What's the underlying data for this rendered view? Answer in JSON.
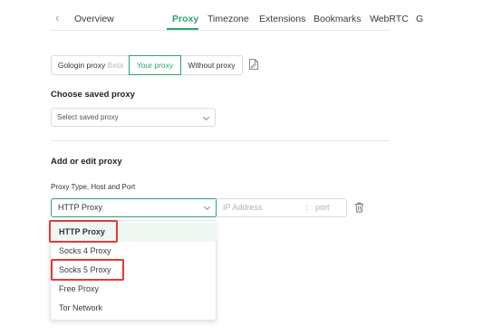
{
  "tabs": {
    "prev_arrow": "‹",
    "next_arrow": "›",
    "items": [
      "Overview",
      "Proxy",
      "Timezone",
      "Extensions",
      "Bookmarks",
      "WebRTC",
      "G"
    ],
    "active": "Proxy"
  },
  "proxy_mode": {
    "gologin": "Gologin proxy",
    "beta": "Beta",
    "your": "Your proxy",
    "without": "Without proxy",
    "selected": "Your proxy"
  },
  "saved": {
    "title": "Choose saved proxy",
    "placeholder": "Select saved proxy"
  },
  "edit": {
    "title": "Add or edit proxy",
    "field_label": "Proxy Type, Host and Port",
    "type_value": "HTTP Proxy",
    "ip_placeholder": "IP Address",
    "colon": ":",
    "port_placeholder": "port"
  },
  "dropdown": {
    "options": [
      "HTTP Proxy",
      "Socks 4 Proxy",
      "Socks 5 Proxy",
      "Free Proxy",
      "Tor Network"
    ],
    "selected": "HTTP Proxy"
  },
  "colors": {
    "accent": "#2ba36b",
    "highlight": "#e53935"
  }
}
